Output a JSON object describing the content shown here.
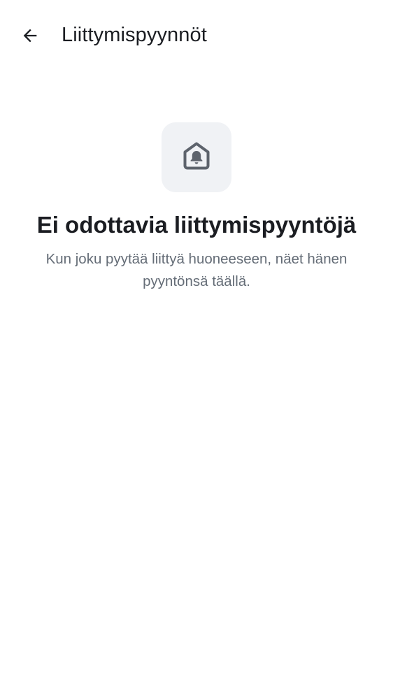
{
  "header": {
    "title": "Liittymispyynnöt",
    "back_icon": "arrow-left-icon"
  },
  "empty_state": {
    "icon": "house-bell-icon",
    "title": "Ei odottavia liittymispyyntöjä",
    "description": "Kun joku pyytää liittyä huoneeseen, näet hänen pyyntönsä täällä."
  },
  "colors": {
    "text_primary": "#1b1d22",
    "text_secondary": "#656d77",
    "icon_tile_bg": "#f0f2f5",
    "icon_color": "#5d636c",
    "background": "#ffffff"
  }
}
